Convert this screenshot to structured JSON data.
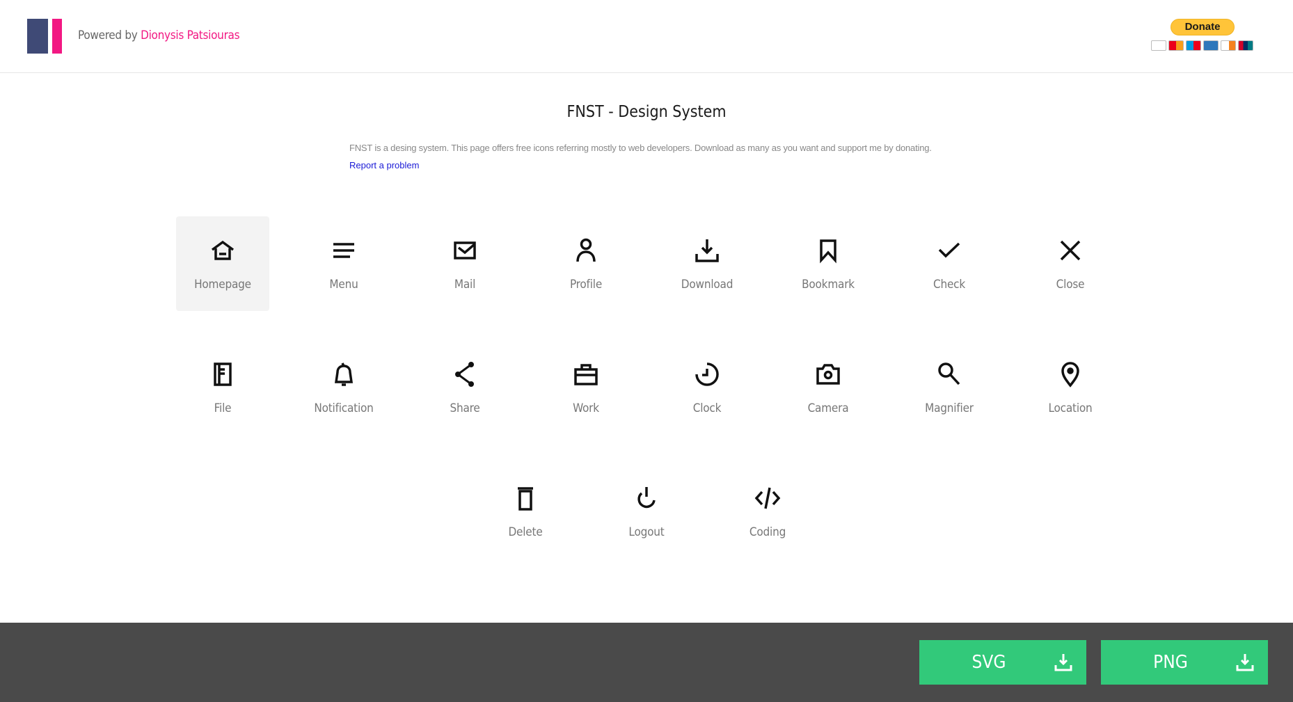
{
  "header": {
    "powered_prefix": "Powered by",
    "powered_author": "Dionysis Patsiouras",
    "donate_label": "Donate",
    "card_icons": [
      "visa-card-icon",
      "mastercard-icon",
      "maestro-icon",
      "amex-icon",
      "discover-icon",
      "unionpay-icon"
    ],
    "brand_colors": {
      "logo_blue": "#3f4a76",
      "logo_pink": "#f21883"
    }
  },
  "main": {
    "title": "FNST - Design System",
    "description": "FNST is a desing system. This page offers free icons referring mostly to web developers. Download as many as you want and support me by donating.",
    "report_link": "Report a problem"
  },
  "icons": [
    {
      "label": "Homepage",
      "icon": "home-icon",
      "selected": true
    },
    {
      "label": "Menu",
      "icon": "menu-icon"
    },
    {
      "label": "Mail",
      "icon": "mail-icon"
    },
    {
      "label": "Profile",
      "icon": "profile-icon"
    },
    {
      "label": "Download",
      "icon": "download-icon"
    },
    {
      "label": "Bookmark",
      "icon": "bookmark-icon"
    },
    {
      "label": "Check",
      "icon": "check-icon"
    },
    {
      "label": "Close",
      "icon": "close-icon"
    },
    {
      "label": "File",
      "icon": "file-icon"
    },
    {
      "label": "Notification",
      "icon": "bell-icon"
    },
    {
      "label": "Share",
      "icon": "share-icon"
    },
    {
      "label": "Work",
      "icon": "briefcase-icon"
    },
    {
      "label": "Clock",
      "icon": "clock-icon"
    },
    {
      "label": "Camera",
      "icon": "camera-icon"
    },
    {
      "label": "Magnifier",
      "icon": "magnifier-icon"
    },
    {
      "label": "Location",
      "icon": "location-icon"
    },
    {
      "label": "Delete",
      "icon": "trash-icon"
    },
    {
      "label": "Logout",
      "icon": "power-icon"
    },
    {
      "label": "Coding",
      "icon": "code-icon"
    }
  ],
  "footer": {
    "svg_label": "SVG",
    "png_label": "PNG",
    "accent_color": "#32c97a"
  }
}
